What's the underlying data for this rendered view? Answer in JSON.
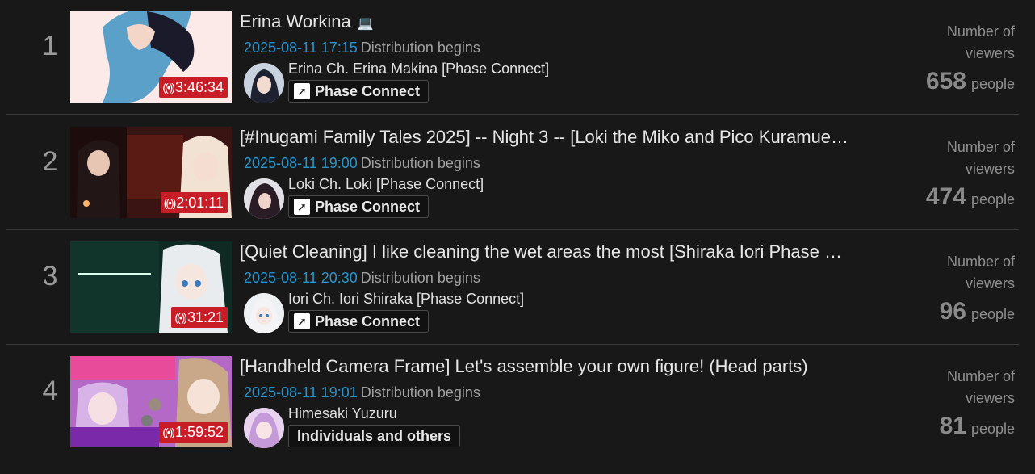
{
  "viewer_label": "Number of viewers",
  "unit_label": "people",
  "time_label": "Distribution begins",
  "items": [
    {
      "rank": "1",
      "duration": "3:46:34",
      "title": "Erina Workina",
      "title_icon": "laptop-icon",
      "datetime": "2025-08-11 17:15",
      "channel": "Erina Ch. Erina Makina [Phase Connect]",
      "group": "Phase Connect",
      "group_icon": "phase-connect-icon",
      "viewers": "658"
    },
    {
      "rank": "2",
      "duration": "2:01:11",
      "title": "[#Inugami Family Tales 2025] -- Night 3 -- [Loki the Miko and Pico Kuramue…",
      "datetime": "2025-08-11 19:00",
      "channel": "Loki Ch. Loki [Phase Connect]",
      "group": "Phase Connect",
      "group_icon": "phase-connect-icon",
      "viewers": "474"
    },
    {
      "rank": "3",
      "duration": "31:21",
      "title": "[Quiet Cleaning] I like cleaning the wet areas the most [Shiraka Iori Phase …",
      "datetime": "2025-08-11 20:30",
      "channel": "Iori Ch. Iori Shiraka [Phase Connect]",
      "group": "Phase Connect",
      "group_icon": "phase-connect-icon",
      "viewers": "96"
    },
    {
      "rank": "4",
      "duration": "1:59:52",
      "title": "[Handheld Camera Frame] Let's assemble your own figure! (Head parts)",
      "datetime": "2025-08-11 19:01",
      "channel": "Himesaki Yuzuru",
      "group": "Individuals and others",
      "viewers": "81"
    }
  ]
}
